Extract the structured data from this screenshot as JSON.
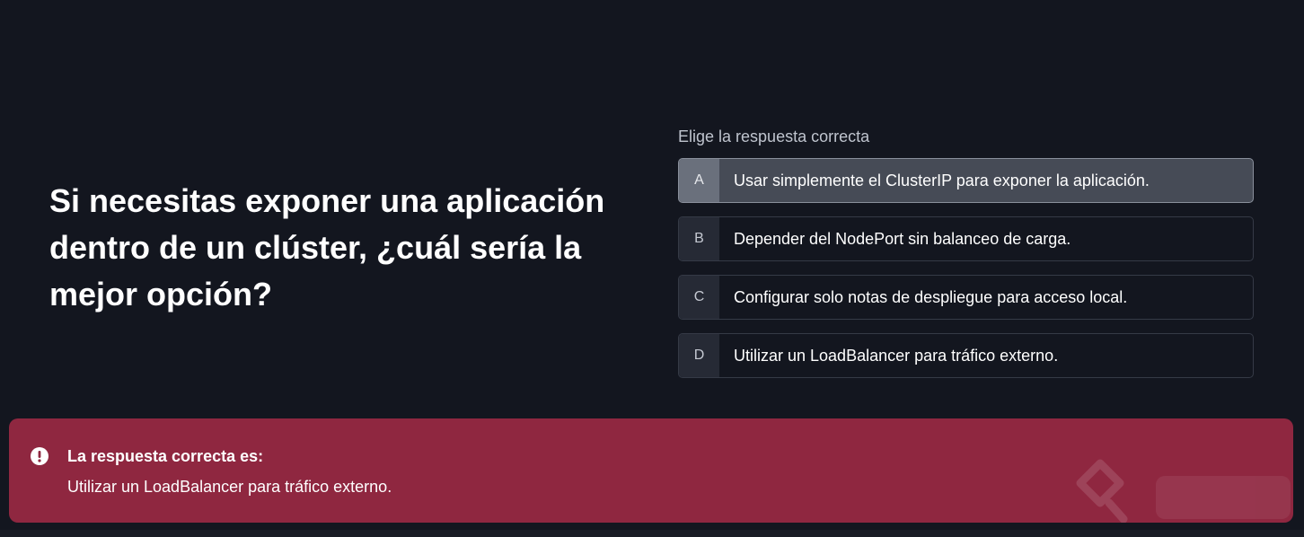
{
  "question": {
    "text": "Si necesitas exponer una aplicación dentro de un clúster, ¿cuál sería la mejor opción?"
  },
  "answers": {
    "instruction": "Elige la respuesta correcta",
    "options": [
      {
        "letter": "A",
        "text": "Usar simplemente el ClusterIP para exponer la aplicación.",
        "selected": true
      },
      {
        "letter": "B",
        "text": "Depender del NodePort sin balanceo de carga.",
        "selected": false
      },
      {
        "letter": "C",
        "text": "Configurar solo notas de despliegue para acceso local.",
        "selected": false
      },
      {
        "letter": "D",
        "text": "Utilizar un LoadBalancer para tráfico externo.",
        "selected": false
      }
    ]
  },
  "feedback": {
    "title": "La respuesta correcta es:",
    "answer": "Utilizar un LoadBalancer para tráfico externo.",
    "icon": "alert-circle-icon",
    "background_color": "#8f2740"
  },
  "colors": {
    "page_background": "#13161f",
    "selected_option": "#464b56",
    "option_border": "#353a46"
  }
}
